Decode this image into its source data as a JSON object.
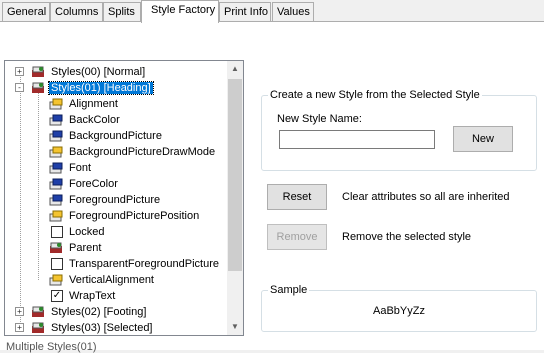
{
  "tabs": [
    {
      "label": "General"
    },
    {
      "label": "Columns"
    },
    {
      "label": "Splits"
    },
    {
      "label": "Style Factory"
    },
    {
      "label": "Print Info"
    },
    {
      "label": "Values"
    }
  ],
  "tree": {
    "nodes": [
      {
        "label": "Styles(00) [Normal]",
        "expander": "+"
      },
      {
        "label": "Styles(01) [Heading]",
        "expander": "-"
      },
      {
        "label": "Alignment"
      },
      {
        "label": "BackColor"
      },
      {
        "label": "BackgroundPicture"
      },
      {
        "label": "BackgroundPictureDrawMode"
      },
      {
        "label": "Font"
      },
      {
        "label": "ForeColor"
      },
      {
        "label": "ForegroundPicture"
      },
      {
        "label": "ForegroundPicturePosition"
      },
      {
        "label": "Locked",
        "checked": false
      },
      {
        "label": "Parent"
      },
      {
        "label": "TransparentForegroundPicture",
        "checked": false
      },
      {
        "label": "VerticalAlignment"
      },
      {
        "label": "WrapText",
        "checked": true,
        "check_mark": "✓"
      },
      {
        "label": "Styles(02) [Footing]",
        "expander": "+"
      },
      {
        "label": "Styles(03) [Selected]",
        "expander": "+"
      }
    ]
  },
  "create_group": {
    "legend": "Create a new Style from the Selected Style",
    "name_label": "New Style Name:",
    "name_value": "",
    "new_button": "New"
  },
  "reset": {
    "button": "Reset",
    "description": "Clear attributes so all are inherited"
  },
  "remove": {
    "button": "Remove",
    "description": "Remove the selected style"
  },
  "sample": {
    "legend": "Sample",
    "text": "AaBbYyZz"
  },
  "status": {
    "text": "Multiple Styles(01)"
  }
}
